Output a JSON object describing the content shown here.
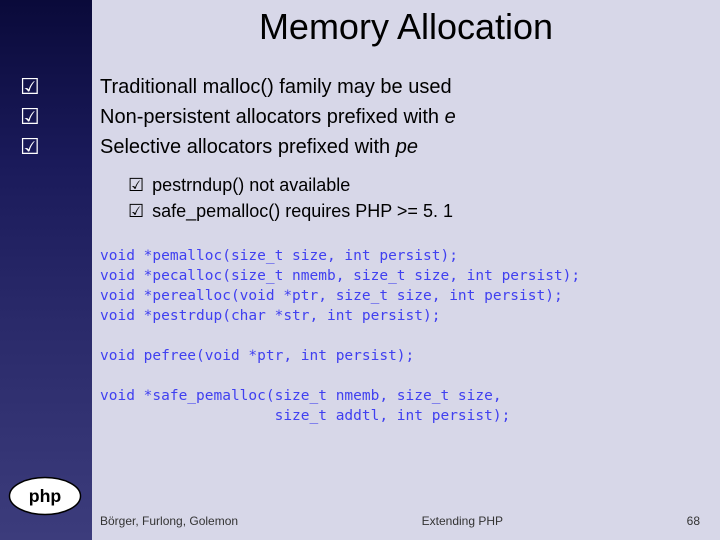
{
  "title": "Memory Allocation",
  "bullets": [
    {
      "pre": "Traditionall malloc() family may be used",
      "em": ""
    },
    {
      "pre": "Non-persistent allocators prefixed with ",
      "em": "e"
    },
    {
      "pre": "Selective allocators prefixed with ",
      "em": "pe"
    }
  ],
  "subbullets": [
    "pestrndup() not available",
    "safe_pemalloc() requires PHP >= 5. 1"
  ],
  "code": "void *pemalloc(size_t size, int persist);\nvoid *pecalloc(size_t nmemb, size_t size, int persist);\nvoid *perealloc(void *ptr, size_t size, int persist);\nvoid *pestrdup(char *str, int persist);\n\nvoid pefree(void *ptr, int persist);\n\nvoid *safe_pemalloc(size_t nmemb, size_t size,\n                    size_t addtl, int persist);",
  "footer": {
    "left": "Börger, Furlong, Golemon",
    "mid": "Extending PHP",
    "right": "68"
  },
  "checkmark": "☑"
}
